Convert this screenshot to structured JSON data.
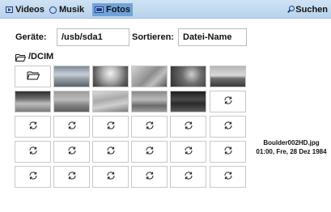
{
  "tabs": [
    {
      "label": "Videos",
      "icon": "video-icon",
      "active": false
    },
    {
      "label": "Musik",
      "icon": "music-icon",
      "active": false
    },
    {
      "label": "Fotos",
      "icon": "photo-icon",
      "active": true
    }
  ],
  "search": {
    "label": "Suchen",
    "icon": "search-icon"
  },
  "filters": {
    "device_label": "Geräte:",
    "device_value": "/usb/sda1",
    "sort_label": "Sortieren:",
    "sort_value": "Datei-Name"
  },
  "current_path": "/DCIM",
  "grid": {
    "rows": 5,
    "cols": 6,
    "cells": [
      "folder-up",
      "thumbnail",
      "thumbnail",
      "thumbnail",
      "thumbnail",
      "thumbnail",
      "thumbnail",
      "thumbnail",
      "thumbnail",
      "thumbnail",
      "thumbnail",
      "loading",
      "loading",
      "loading",
      "loading",
      "loading",
      "loading",
      "loading",
      "loading",
      "loading",
      "loading",
      "loading",
      "loading",
      "loading",
      "loading",
      "loading",
      "loading",
      "loading",
      "loading",
      "loading"
    ]
  },
  "selected_file": {
    "name": "Boulder002HD.jpg",
    "datetime": "01:00, Fre, 28 Dez 1984"
  },
  "colors": {
    "topbar": "#b8d3ec",
    "active_tab": "#6fa3d9",
    "icon_blue": "#1a3c8c",
    "cell_border": "#c8c8c8"
  }
}
